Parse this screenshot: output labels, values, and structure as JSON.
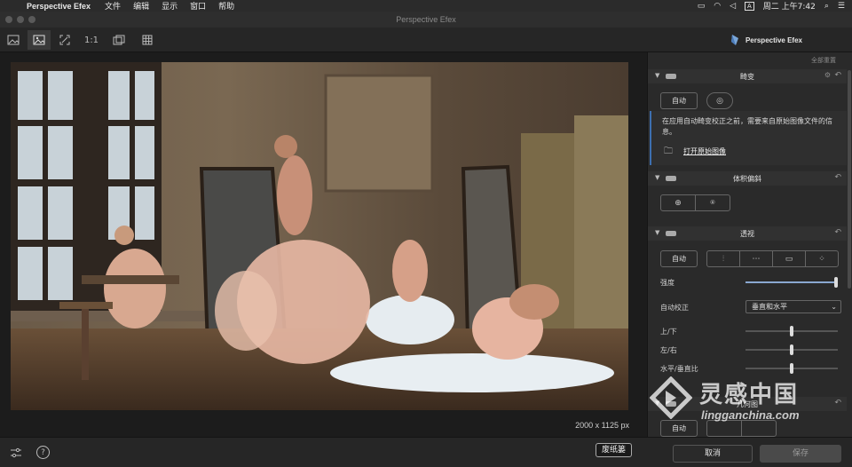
{
  "menubar": {
    "app_name": "Perspective Efex",
    "menus": [
      "文件",
      "编辑",
      "显示",
      "窗口",
      "帮助"
    ],
    "clock": "周二 上午7:42",
    "input_method": "A"
  },
  "window": {
    "title": "Perspective Efex"
  },
  "toolbar": {
    "zoom_label": "1:1",
    "brand": "Perspective Efex"
  },
  "canvas": {
    "dimensions": "2000 x 1125 px"
  },
  "panel": {
    "reset_all": "全部重置",
    "distortion": {
      "title": "畸变",
      "auto_label": "自动",
      "info_text": "在应用自动畸变校正之前，需要来自原始图像文件的信息。",
      "open_original": "打开原始图像"
    },
    "volume": {
      "title": "体积偏斜"
    },
    "perspective": {
      "title": "透视",
      "auto_label": "自动",
      "strength_label": "强度",
      "strength_value": 1.0,
      "auto_correct_label": "自动校正",
      "auto_correct_value": "垂直和水平",
      "vertical_label": "上/下",
      "vertical_value": 0.5,
      "horizontal_label": "左/右",
      "horizontal_value": 0.5,
      "ratio_label": "水平/垂直比",
      "ratio_value": 0.5
    },
    "geometry": {
      "title": "几何图",
      "auto_label": "自动"
    }
  },
  "bottombar": {
    "loupe_label": "废纸篓",
    "cancel_label": "取消",
    "save_label": "保存"
  },
  "watermark": {
    "cn": "灵感中国",
    "en": "lingganchina.com"
  },
  "colors": {
    "accent": "#3d6fb0",
    "panel_bg": "#2a2a2a",
    "header_bg": "#313131"
  }
}
